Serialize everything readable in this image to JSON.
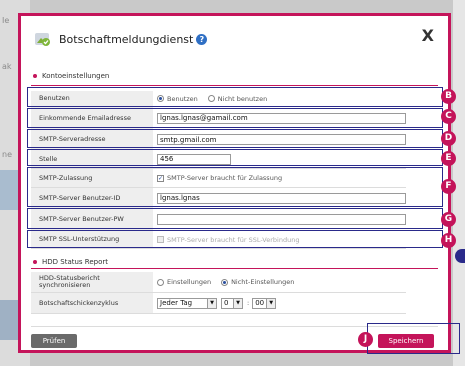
{
  "background": {
    "left_fragments": [
      "Ie",
      "ak",
      "ne"
    ]
  },
  "dialog": {
    "title": "Botschaftmeldungdienst",
    "help_label": "?",
    "close_label": "X",
    "accent_color": "#c4145a"
  },
  "account_section": {
    "heading": "Kontoeinstellungen",
    "use_label": "Benutzen",
    "use_options": [
      "Benutzen",
      "Nicht benutzen"
    ],
    "use_selected": "Benutzen",
    "incoming_email_label": "Einkommende Emailadresse",
    "incoming_email_value": "lgnas.lgnas@gamail.com",
    "smtp_server_label": "SMTP-Serveradresse",
    "smtp_server_value": "smtp.gmail.com",
    "port_label": "Stelle",
    "port_value": "456",
    "smtp_auth_label": "SMTP-Zulassung",
    "smtp_auth_checkbox": "SMTP-Server braucht für Zulassung",
    "smtp_user_label": "SMTP-Server Benutzer-ID",
    "smtp_user_value": "lgnas.lgnas",
    "smtp_pw_label": "SMTP-Server Benutzer-PW",
    "smtp_pw_value": "",
    "ssl_label": "SMTP SSL-Unterstützung",
    "ssl_checkbox": "SMTP-Server braucht für SSL-Verbindung"
  },
  "hdd_section": {
    "heading": "HDD Status Report",
    "sync_label": "HDD-Statusbericht synchronisieren",
    "sync_options": [
      "Einstellungen",
      "Nicht-Einstellungen"
    ],
    "sync_selected": "Nicht-Einstellungen",
    "cycle_label": "Botschaftschickenzyklus",
    "cycle_day": "Jeder Tag",
    "cycle_hour": "0",
    "cycle_minute": "00"
  },
  "footer": {
    "check_button": "Prüfen",
    "save_button": "Speichern"
  },
  "callouts": [
    "B",
    "C",
    "D",
    "E",
    "F",
    "G",
    "H",
    "J"
  ]
}
